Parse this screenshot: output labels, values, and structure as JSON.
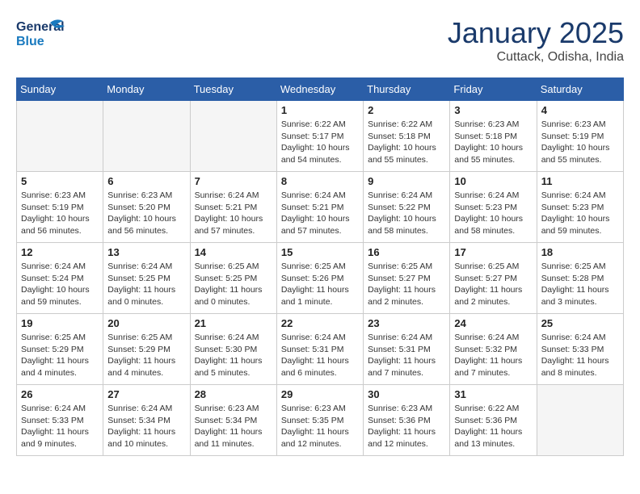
{
  "header": {
    "logo_general": "General",
    "logo_blue": "Blue",
    "month_title": "January 2025",
    "location": "Cuttack, Odisha, India"
  },
  "days_of_week": [
    "Sunday",
    "Monday",
    "Tuesday",
    "Wednesday",
    "Thursday",
    "Friday",
    "Saturday"
  ],
  "weeks": [
    [
      {
        "day": "",
        "info": ""
      },
      {
        "day": "",
        "info": ""
      },
      {
        "day": "",
        "info": ""
      },
      {
        "day": "1",
        "info": "Sunrise: 6:22 AM\nSunset: 5:17 PM\nDaylight: 10 hours\nand 54 minutes."
      },
      {
        "day": "2",
        "info": "Sunrise: 6:22 AM\nSunset: 5:18 PM\nDaylight: 10 hours\nand 55 minutes."
      },
      {
        "day": "3",
        "info": "Sunrise: 6:23 AM\nSunset: 5:18 PM\nDaylight: 10 hours\nand 55 minutes."
      },
      {
        "day": "4",
        "info": "Sunrise: 6:23 AM\nSunset: 5:19 PM\nDaylight: 10 hours\nand 55 minutes."
      }
    ],
    [
      {
        "day": "5",
        "info": "Sunrise: 6:23 AM\nSunset: 5:19 PM\nDaylight: 10 hours\nand 56 minutes."
      },
      {
        "day": "6",
        "info": "Sunrise: 6:23 AM\nSunset: 5:20 PM\nDaylight: 10 hours\nand 56 minutes."
      },
      {
        "day": "7",
        "info": "Sunrise: 6:24 AM\nSunset: 5:21 PM\nDaylight: 10 hours\nand 57 minutes."
      },
      {
        "day": "8",
        "info": "Sunrise: 6:24 AM\nSunset: 5:21 PM\nDaylight: 10 hours\nand 57 minutes."
      },
      {
        "day": "9",
        "info": "Sunrise: 6:24 AM\nSunset: 5:22 PM\nDaylight: 10 hours\nand 58 minutes."
      },
      {
        "day": "10",
        "info": "Sunrise: 6:24 AM\nSunset: 5:23 PM\nDaylight: 10 hours\nand 58 minutes."
      },
      {
        "day": "11",
        "info": "Sunrise: 6:24 AM\nSunset: 5:23 PM\nDaylight: 10 hours\nand 59 minutes."
      }
    ],
    [
      {
        "day": "12",
        "info": "Sunrise: 6:24 AM\nSunset: 5:24 PM\nDaylight: 10 hours\nand 59 minutes."
      },
      {
        "day": "13",
        "info": "Sunrise: 6:24 AM\nSunset: 5:25 PM\nDaylight: 11 hours\nand 0 minutes."
      },
      {
        "day": "14",
        "info": "Sunrise: 6:25 AM\nSunset: 5:25 PM\nDaylight: 11 hours\nand 0 minutes."
      },
      {
        "day": "15",
        "info": "Sunrise: 6:25 AM\nSunset: 5:26 PM\nDaylight: 11 hours\nand 1 minute."
      },
      {
        "day": "16",
        "info": "Sunrise: 6:25 AM\nSunset: 5:27 PM\nDaylight: 11 hours\nand 2 minutes."
      },
      {
        "day": "17",
        "info": "Sunrise: 6:25 AM\nSunset: 5:27 PM\nDaylight: 11 hours\nand 2 minutes."
      },
      {
        "day": "18",
        "info": "Sunrise: 6:25 AM\nSunset: 5:28 PM\nDaylight: 11 hours\nand 3 minutes."
      }
    ],
    [
      {
        "day": "19",
        "info": "Sunrise: 6:25 AM\nSunset: 5:29 PM\nDaylight: 11 hours\nand 4 minutes."
      },
      {
        "day": "20",
        "info": "Sunrise: 6:25 AM\nSunset: 5:29 PM\nDaylight: 11 hours\nand 4 minutes."
      },
      {
        "day": "21",
        "info": "Sunrise: 6:24 AM\nSunset: 5:30 PM\nDaylight: 11 hours\nand 5 minutes."
      },
      {
        "day": "22",
        "info": "Sunrise: 6:24 AM\nSunset: 5:31 PM\nDaylight: 11 hours\nand 6 minutes."
      },
      {
        "day": "23",
        "info": "Sunrise: 6:24 AM\nSunset: 5:31 PM\nDaylight: 11 hours\nand 7 minutes."
      },
      {
        "day": "24",
        "info": "Sunrise: 6:24 AM\nSunset: 5:32 PM\nDaylight: 11 hours\nand 7 minutes."
      },
      {
        "day": "25",
        "info": "Sunrise: 6:24 AM\nSunset: 5:33 PM\nDaylight: 11 hours\nand 8 minutes."
      }
    ],
    [
      {
        "day": "26",
        "info": "Sunrise: 6:24 AM\nSunset: 5:33 PM\nDaylight: 11 hours\nand 9 minutes."
      },
      {
        "day": "27",
        "info": "Sunrise: 6:24 AM\nSunset: 5:34 PM\nDaylight: 11 hours\nand 10 minutes."
      },
      {
        "day": "28",
        "info": "Sunrise: 6:23 AM\nSunset: 5:34 PM\nDaylight: 11 hours\nand 11 minutes."
      },
      {
        "day": "29",
        "info": "Sunrise: 6:23 AM\nSunset: 5:35 PM\nDaylight: 11 hours\nand 12 minutes."
      },
      {
        "day": "30",
        "info": "Sunrise: 6:23 AM\nSunset: 5:36 PM\nDaylight: 11 hours\nand 12 minutes."
      },
      {
        "day": "31",
        "info": "Sunrise: 6:22 AM\nSunset: 5:36 PM\nDaylight: 11 hours\nand 13 minutes."
      },
      {
        "day": "",
        "info": ""
      }
    ]
  ]
}
